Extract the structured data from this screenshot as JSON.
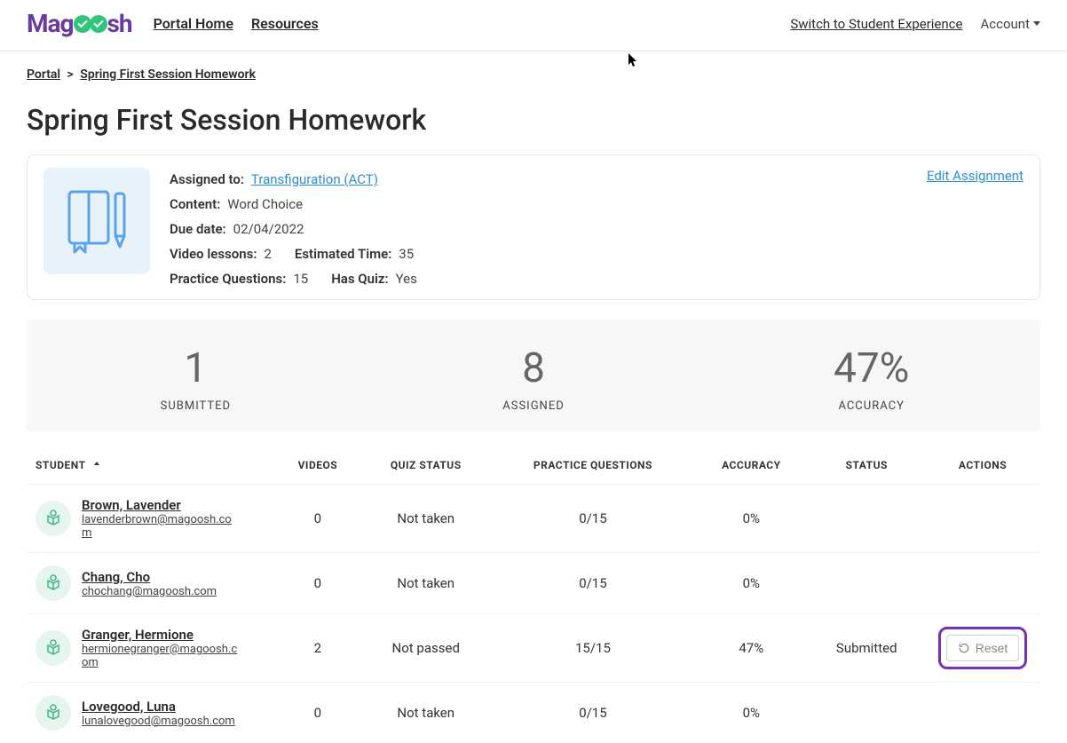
{
  "header": {
    "logo_text_left": "Mag",
    "logo_text_right": "sh",
    "nav": {
      "portal_home": "Portal Home",
      "resources": "Resources"
    },
    "switch_link": "Switch to Student Experience",
    "account": "Account"
  },
  "breadcrumb": {
    "portal": "Portal",
    "sep": ">",
    "current": "Spring First Session Homework"
  },
  "page_title": "Spring First Session Homework",
  "panel": {
    "assigned_to_label": "Assigned to:",
    "assigned_to_value": "Transfiguration (ACT)",
    "content_label": "Content:",
    "content_value": "Word Choice",
    "due_label": "Due date:",
    "due_value": "02/04/2022",
    "videos_label": "Video lessons:",
    "videos_value": "2",
    "est_label": "Estimated Time:",
    "est_value": "35",
    "pq_label": "Practice Questions:",
    "pq_value": "15",
    "quiz_label": "Has Quiz:",
    "quiz_value": "Yes",
    "edit_link": "Edit Assignment"
  },
  "stats": {
    "submitted_num": "1",
    "submitted_lab": "SUBMITTED",
    "assigned_num": "8",
    "assigned_lab": "ASSIGNED",
    "accuracy_num": "47%",
    "accuracy_lab": "ACCURACY"
  },
  "table": {
    "headers": {
      "student": "STUDENT",
      "videos": "VIDEOS",
      "quiz": "QUIZ STATUS",
      "pq": "PRACTICE QUESTIONS",
      "accuracy": "ACCURACY",
      "status": "STATUS",
      "actions": "ACTIONS"
    },
    "rows": [
      {
        "name": "Brown, Lavender",
        "email": "lavenderbrown@magoosh.com",
        "videos": "0",
        "quiz": "Not taken",
        "pq": "0/15",
        "accuracy": "0%",
        "status": "",
        "reset": false
      },
      {
        "name": "Chang, Cho",
        "email": "chochang@magoosh.com",
        "videos": "0",
        "quiz": "Not taken",
        "pq": "0/15",
        "accuracy": "0%",
        "status": "",
        "reset": false
      },
      {
        "name": "Granger, Hermione",
        "email": "hermionegranger@magoosh.com",
        "videos": "2",
        "quiz": "Not passed",
        "pq": "15/15",
        "accuracy": "47%",
        "status": "Submitted",
        "reset": true
      },
      {
        "name": "Lovegood, Luna",
        "email": "lunalovegood@magoosh.com",
        "videos": "0",
        "quiz": "Not taken",
        "pq": "0/15",
        "accuracy": "0%",
        "status": "",
        "reset": false
      }
    ],
    "reset_label": "Reset"
  }
}
